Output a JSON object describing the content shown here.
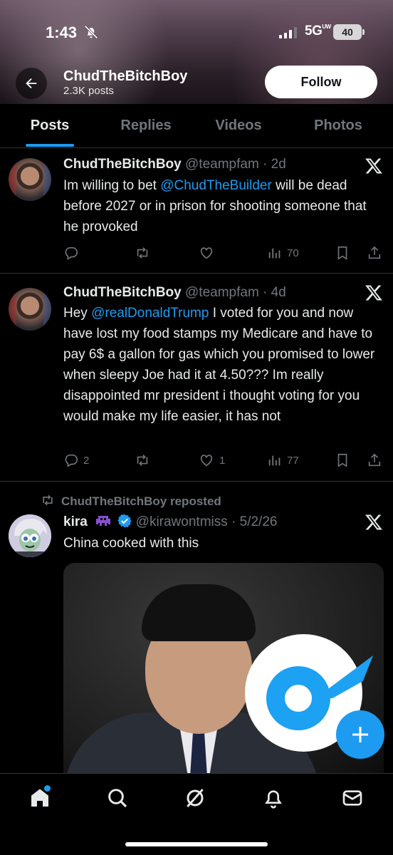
{
  "status_bar": {
    "time": "1:43",
    "network": "5G",
    "network_sup": "UW",
    "battery": "40"
  },
  "profile": {
    "name": "ChudTheBitchBoy",
    "posts": "2.3K posts",
    "follow_label": "Follow"
  },
  "tabs": [
    {
      "label": "Posts",
      "active": true
    },
    {
      "label": "Replies",
      "active": false
    },
    {
      "label": "Videos",
      "active": false
    },
    {
      "label": "Photos",
      "active": false
    }
  ],
  "tweets": [
    {
      "display_name": "ChudTheBitchBoy",
      "handle_time": "@teampfam · 2d",
      "text_pre": "Im willing to bet ",
      "mention": "@ChudTheBuilder",
      "text_post": " will be dead before 2027 or in prison for shooting someone that he provoked",
      "replies": "",
      "reposts": "",
      "likes": "",
      "views": "70"
    },
    {
      "display_name": "ChudTheBitchBoy",
      "handle_time": "@teampfam · 4d",
      "text_pre": "Hey ",
      "mention": "@realDonaldTrump",
      "text_post": " I voted for you and now have lost my food stamps my Medicare and have to pay 6$ a gallon for gas which you promised to lower when sleepy Joe had it at 4.50??? Im really disappointed mr president i thought voting for you would make my life easier, it has not",
      "replies": "2",
      "reposts": "",
      "likes": "1",
      "views": "77"
    },
    {
      "repost_label": "ChudTheBitchBoy reposted",
      "display_name": "kira",
      "handle_time": "@kirawontmiss · 5/2/26",
      "text": "China cooked with this"
    }
  ],
  "colors": {
    "accent": "#1d9bf0",
    "text": "#e7e9ea",
    "muted": "#71767b",
    "divider": "#2f3336"
  },
  "icons": [
    "back-arrow-icon",
    "bell-slash-icon",
    "x-logo-icon",
    "reply-icon",
    "repost-icon",
    "like-icon",
    "views-icon",
    "bookmark-icon",
    "share-icon",
    "verified-icon",
    "alien-emoji-icon",
    "plus-icon",
    "home-icon",
    "search-icon",
    "grok-icon",
    "notifications-icon",
    "messages-icon"
  ]
}
